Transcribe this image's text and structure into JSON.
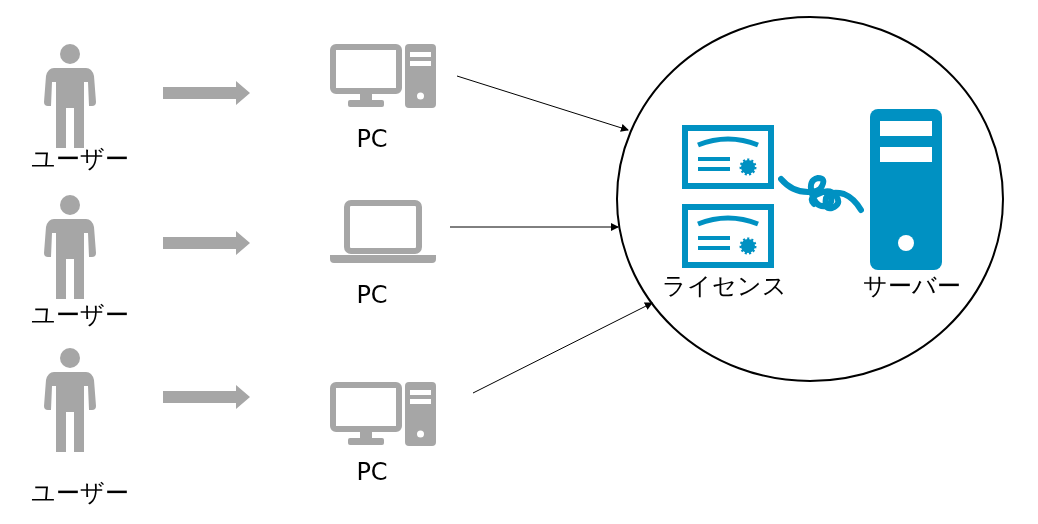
{
  "rows": [
    {
      "user_label": "ユーザー",
      "device": {
        "kind": "desktop",
        "label": "PC"
      }
    },
    {
      "user_label": "ユーザー",
      "device": {
        "kind": "laptop",
        "label": "PC"
      }
    },
    {
      "user_label": "ユーザー",
      "device": {
        "kind": "desktop",
        "label": "PC"
      }
    }
  ],
  "license": {
    "label": "ライセンス"
  },
  "server": {
    "label": "サーバー"
  }
}
